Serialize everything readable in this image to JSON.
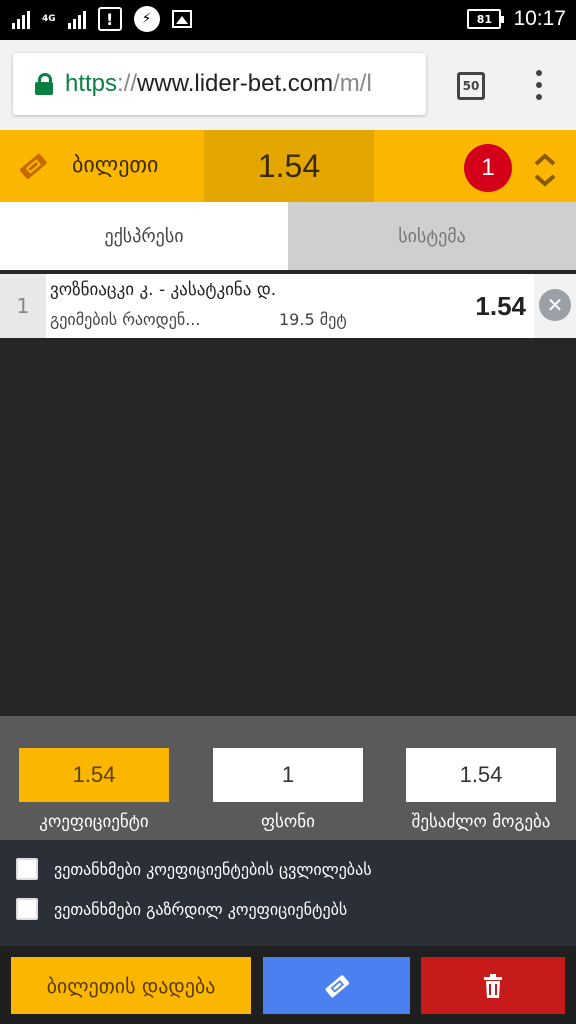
{
  "status_bar": {
    "network": "4G",
    "battery": "81",
    "time": "10:17"
  },
  "browser": {
    "url_scheme": "https",
    "url_sep": "://",
    "url_host": "www.lider-bet.com",
    "url_path": "/m/l",
    "tab_count": "50"
  },
  "ticket": {
    "label": "ბილეთი",
    "total_odds": "1.54",
    "bet_count": "1"
  },
  "tabs": {
    "express": "ექსპრესი",
    "system": "სისტემა"
  },
  "bet": {
    "index": "1",
    "title": "ვოზნიაცკი კ. - კასატკინა დ.",
    "market": "გეიმების რაოდენ...",
    "line": "19.5 მეტ",
    "odds": "1.54"
  },
  "stake": {
    "coefficient_value": "1.54",
    "coefficient_label": "კოეფიციენტი",
    "amount_value": "1",
    "amount_label": "ფსონი",
    "payout_value": "1.54",
    "payout_label": "შესაძლო მოგება"
  },
  "options": {
    "accept_changes": "ვეთანხმები კოეფიციენტების ცვლილებას",
    "accept_increased": "ვეთანხმები გაზრდილ კოეფიციენტებს"
  },
  "actions": {
    "place_bet": "ბილეთის დადება"
  },
  "colors": {
    "accent": "#fbb600",
    "accent_dark": "#e4a600",
    "badge": "#d4001a",
    "blue_button": "#4a80f0",
    "red_button": "#c71a1a"
  }
}
